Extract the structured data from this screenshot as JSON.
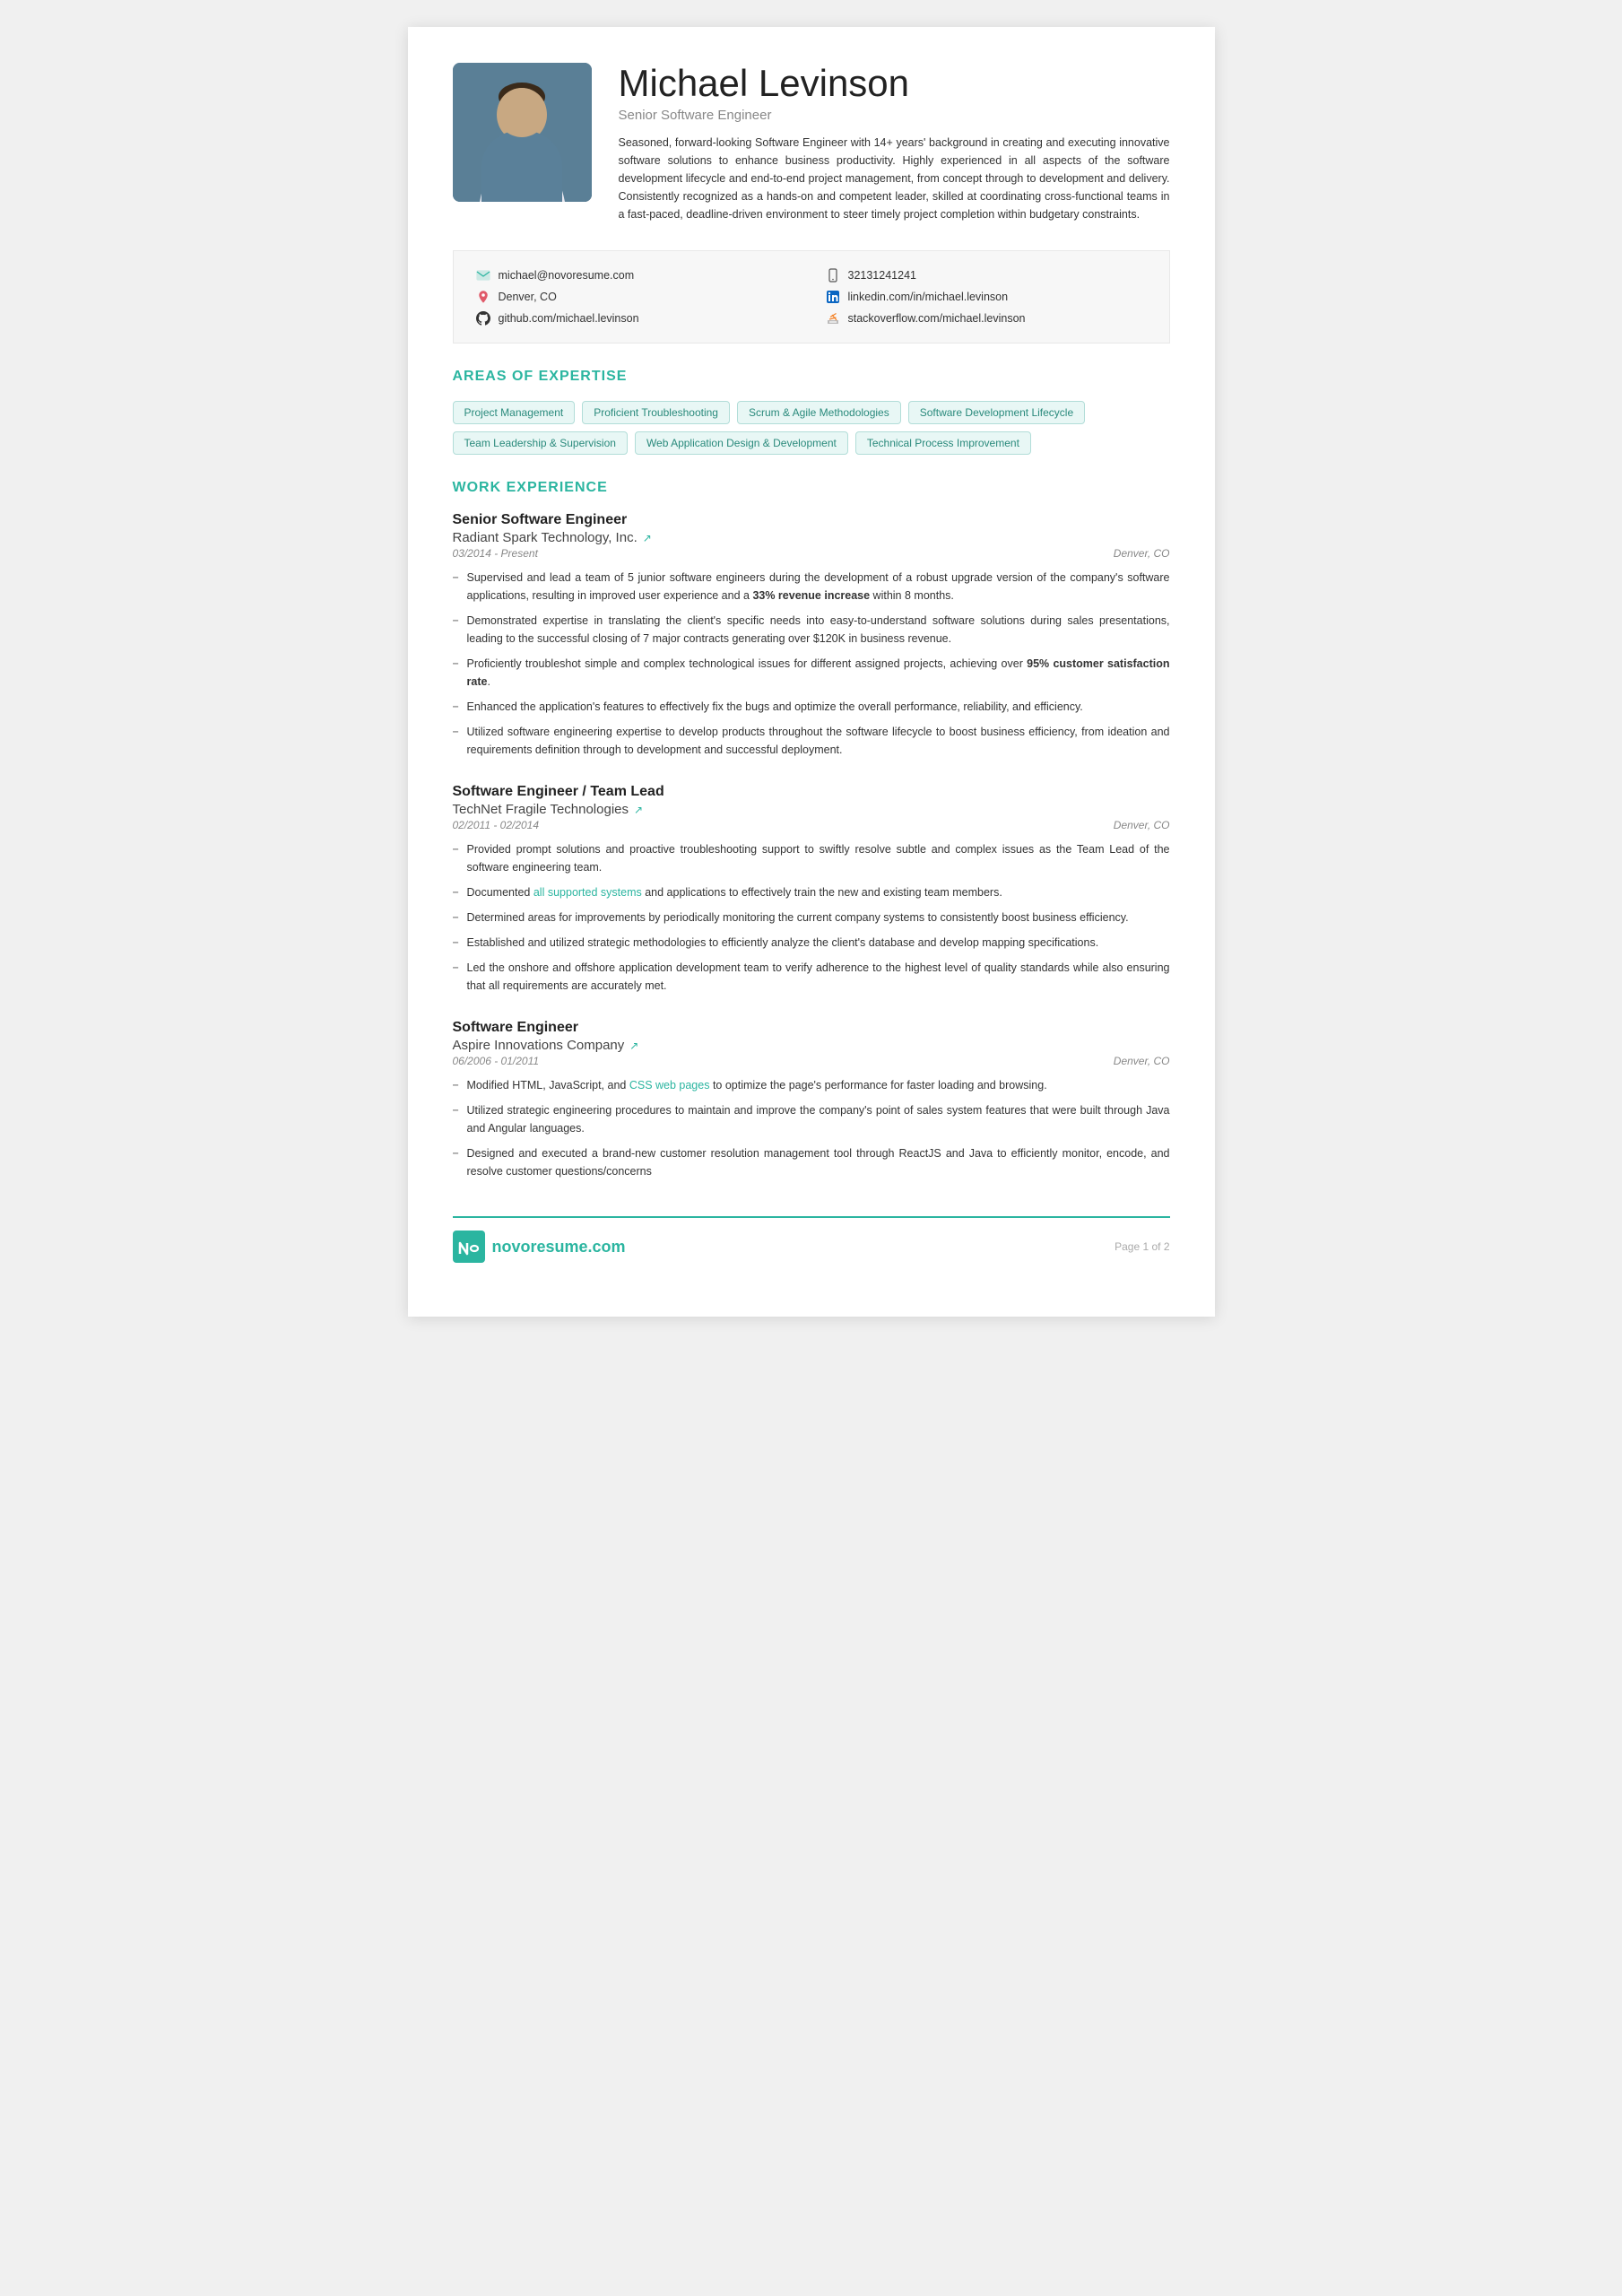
{
  "header": {
    "name": "Michael Levinson",
    "title": "Senior Software Engineer",
    "summary": "Seasoned, forward-looking Software Engineer with 14+ years' background in creating and executing innovative software solutions to enhance business productivity. Highly experienced in all aspects of the software development lifecycle and end-to-end project management, from concept through to development and delivery. Consistently recognized as a hands-on and competent leader, skilled at coordinating cross-functional teams in a fast-paced, deadline-driven environment to steer timely project completion within budgetary constraints."
  },
  "contact": {
    "email": "michael@novoresume.com",
    "location": "Denver, CO",
    "github": "github.com/michael.levinson",
    "phone": "32131241241",
    "linkedin": "linkedin.com/in/michael.levinson",
    "stackoverflow": "stackoverflow.com/michael.levinson"
  },
  "sections": {
    "expertise_title": "AREAS OF EXPERTISE",
    "work_title": "WORK EXPERIENCE"
  },
  "expertise": {
    "tags": [
      "Project Management",
      "Proficient Troubleshooting",
      "Scrum & Agile Methodologies",
      "Software Development Lifecycle",
      "Team Leadership & Supervision",
      "Web Application Design & Development",
      "Technical Process Improvement"
    ]
  },
  "jobs": [
    {
      "title": "Senior Software Engineer",
      "company": "Radiant Spark Technology, Inc.",
      "period": "03/2014 - Present",
      "location": "Denver, CO",
      "bullets": [
        "Supervised and lead a team of 5 junior software engineers during the development of a robust upgrade version of the company's software applications, resulting in improved user experience and a <b>33% revenue increase</b> within 8 months.",
        "Demonstrated expertise in translating the client's specific needs into easy-to-understand software solutions during sales presentations, leading to the successful closing of 7 major contracts generating over $120K in business revenue.",
        "Proficiently troubleshot simple and complex technological issues for different assigned projects, achieving over <b>95% customer satisfaction rate</b>.",
        "Enhanced the application's features to effectively fix the bugs and optimize the overall performance, reliability, and efficiency.",
        "Utilized software engineering expertise to develop products throughout the software lifecycle to boost business efficiency, from ideation and requirements definition through to development and successful deployment."
      ]
    },
    {
      "title": "Software Engineer / Team Lead",
      "company": "TechNet Fragile Technologies",
      "period": "02/2011 - 02/2014",
      "location": "Denver, CO",
      "bullets": [
        "Provided prompt solutions and proactive troubleshooting support to swiftly resolve subtle and complex issues as the Team Lead of the software engineering team.",
        "Documented <a class=\"link-text\" href=\"#\">all supported systems</a> and applications to effectively train the new and existing team members.",
        "Determined areas for improvements by periodically monitoring the current company systems to consistently boost business efficiency.",
        "Established and utilized strategic methodologies to efficiently analyze the client's database and develop mapping specifications.",
        "Led the onshore and offshore application development team to verify adherence to the highest level of quality standards while also ensuring that all requirements are accurately met."
      ]
    },
    {
      "title": "Software Engineer",
      "company": "Aspire Innovations Company",
      "period": "06/2006 - 01/2011",
      "location": "Denver, CO",
      "bullets": [
        "Modified HTML, JavaScript, and <a class=\"link-text\" href=\"#\">CSS web pages</a> to optimize the page's performance for faster loading and browsing.",
        "Utilized strategic engineering procedures to maintain and improve the company's point of sales system features that were built through Java and Angular languages.",
        "Designed and executed a brand-new customer resolution management tool through ReactJS and Java to efficiently monitor, encode, and resolve customer questions/concerns"
      ]
    }
  ],
  "footer": {
    "brand": "novoresume.com",
    "page": "Page 1 of 2"
  }
}
